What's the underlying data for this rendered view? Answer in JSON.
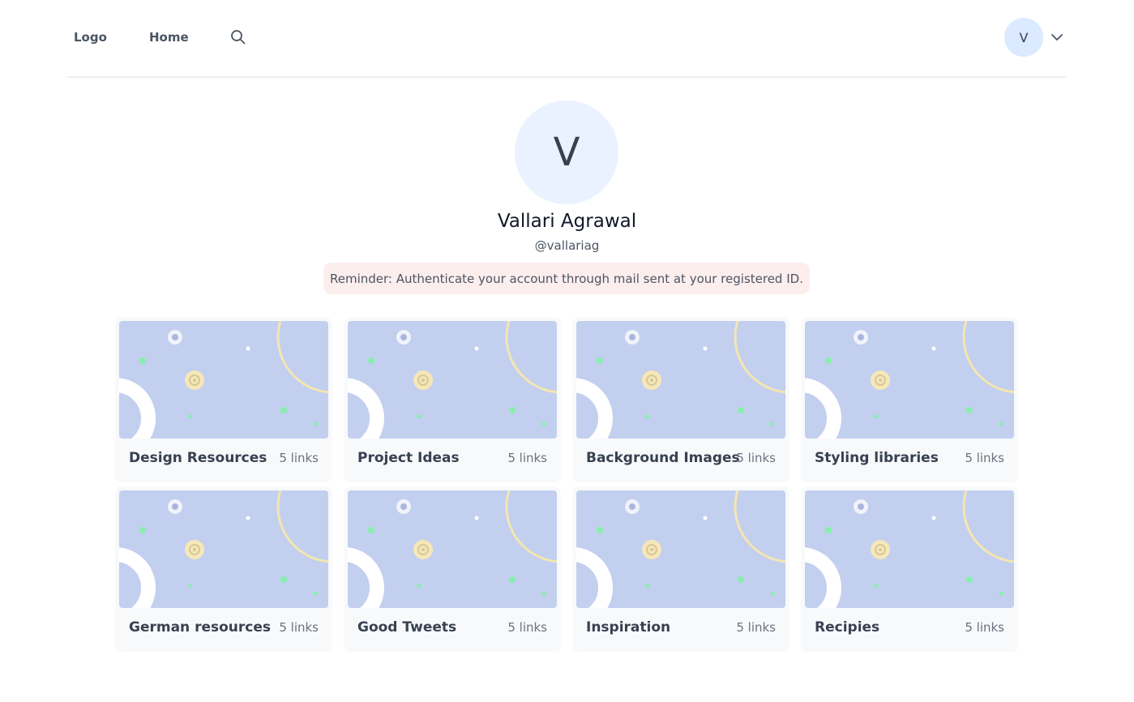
{
  "nav": {
    "logo_label": "Logo",
    "home_label": "Home",
    "search_icon": "search-icon",
    "avatar_initial": "V",
    "menu_icon": "chevron-down-icon"
  },
  "profile": {
    "avatar_initial": "V",
    "name": "Vallari Agrawal",
    "handle": "@vallariag",
    "reminder": "Reminder: Authenticate your account through mail sent at your registered ID."
  },
  "colors": {
    "thumbnail_bg": "#c3cfef",
    "reminder_bg": "#fdeeee",
    "avatar_bg": "#dbeafe"
  },
  "collections": [
    {
      "title": "Design Resources",
      "count": "5 links"
    },
    {
      "title": "Project Ideas",
      "count": "5 links"
    },
    {
      "title": "Background Images",
      "count": "5 links"
    },
    {
      "title": "Styling libraries",
      "count": "5 links"
    },
    {
      "title": "German resources",
      "count": "5 links"
    },
    {
      "title": "Good Tweets",
      "count": "5 links"
    },
    {
      "title": "Inspiration",
      "count": "5 links"
    },
    {
      "title": "Recipies",
      "count": "5 links"
    }
  ]
}
